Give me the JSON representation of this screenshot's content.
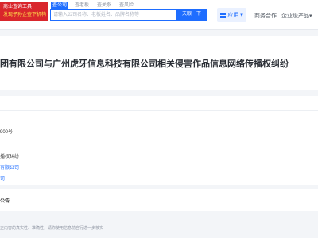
{
  "header": {
    "brand_line1": "商业查询工具",
    "brand_line2": "发现子孙企查下机构",
    "tabs": [
      "查公司",
      "查老板",
      "查关系",
      "查风险"
    ],
    "search_placeholder": "请输入公司名称、老板姓名、品牌名称等",
    "search_button": "天眼一下",
    "app_button": "应用",
    "nav": [
      "商务合作",
      "企业级产品"
    ]
  },
  "case": {
    "title": "团有限公司与广州虎牙信息科技有限公司相关侵害作品信息网络传播权纠纷"
  },
  "details": {
    "case_no": "900号",
    "cause": "播权纠纷",
    "party1": "有限公司",
    "party2": "司"
  },
  "section": {
    "label": "公告"
  },
  "footer": {
    "disclaimer": "正内容的真实性、准确性，请你使用信息前自行进一步核实"
  }
}
